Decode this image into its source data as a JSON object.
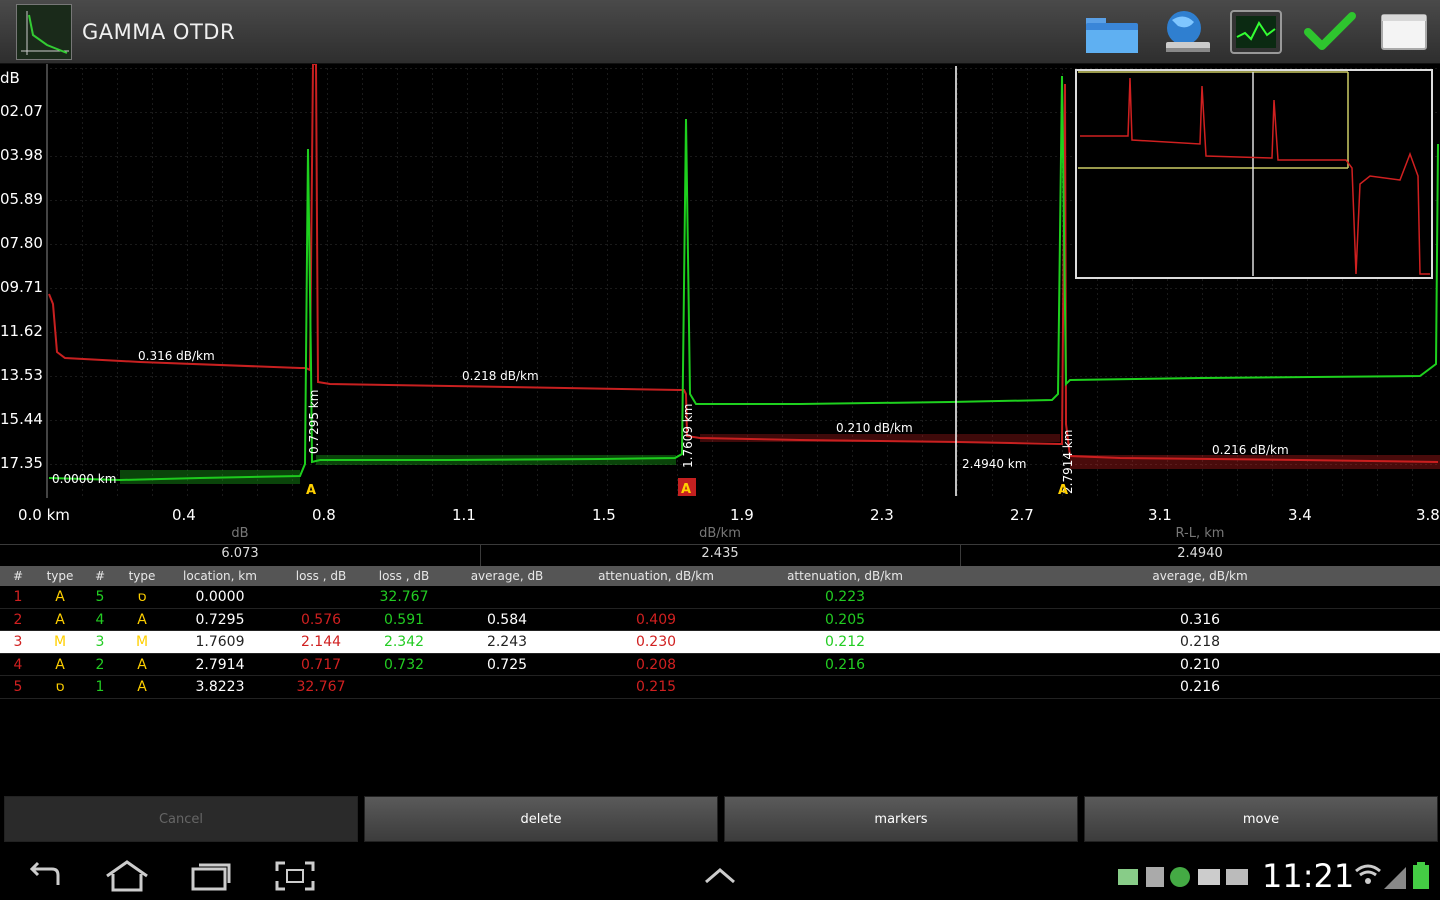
{
  "app": {
    "title": "GAMMA OTDR"
  },
  "toolbar": [
    {
      "name": "folder-icon"
    },
    {
      "name": "network-globe-icon"
    },
    {
      "name": "scope-display-icon"
    },
    {
      "name": "checkmark-icon"
    },
    {
      "name": "window-icon"
    }
  ],
  "chart_data": {
    "type": "line",
    "ylabel": "dB",
    "yticks": [
      "02.07",
      "03.98",
      "05.89",
      "07.80",
      "09.71",
      "11.62",
      "13.53",
      "15.44",
      "17.35"
    ],
    "xticks": [
      "0.0 km",
      "0.4",
      "0.8",
      "1.1",
      "1.5",
      "1.9",
      "2.3",
      "2.7",
      "3.1",
      "3.4",
      "3.8"
    ],
    "annotations": {
      "seg1_slope": "0.316 dB/km",
      "seg2_slope": "0.218 dB/km",
      "seg3_slope": "0.210 dB/km",
      "seg4_slope": "0.216 dB/km",
      "start_marker": "0.0000 km",
      "marker_a": "0.7295 km",
      "marker_b": "1.7609 km",
      "marker_c": "2.4940 km",
      "marker_d": "2.7914 km"
    },
    "series": [
      {
        "color": "#d02020"
      },
      {
        "color": "#22cc22"
      }
    ]
  },
  "summary": {
    "units": [
      "dB",
      "dB/km",
      "R-L, km"
    ],
    "values": [
      "6.073",
      "2.435",
      "2.4940"
    ]
  },
  "table": {
    "headers": [
      "#",
      "type",
      "#",
      "type",
      "location, km",
      "loss , dB",
      "loss , dB",
      "average, dB",
      "attenuation, dB/km",
      "attenuation, dB/km",
      "average, dB/km"
    ],
    "rows": [
      [
        "1",
        "A",
        "5",
        "ס",
        "0.0000",
        "",
        "32.767",
        "",
        "",
        "0.223",
        ""
      ],
      [
        "2",
        "A",
        "4",
        "A",
        "0.7295",
        "0.576",
        "0.591",
        "0.584",
        "0.409",
        "0.205",
        "0.316"
      ],
      [
        "3",
        "M",
        "3",
        "M",
        "1.7609",
        "2.144",
        "2.342",
        "2.243",
        "0.230",
        "0.212",
        "0.218"
      ],
      [
        "4",
        "A",
        "2",
        "A",
        "2.7914",
        "0.717",
        "0.732",
        "0.725",
        "0.208",
        "0.216",
        "0.210"
      ],
      [
        "5",
        "ס",
        "1",
        "A",
        "3.8223",
        "32.767",
        "",
        "",
        "0.215",
        "",
        "0.216"
      ]
    ]
  },
  "actions": [
    "Cancel",
    "delete",
    "markers",
    "move"
  ],
  "statusbar": {
    "time": "11:21"
  }
}
